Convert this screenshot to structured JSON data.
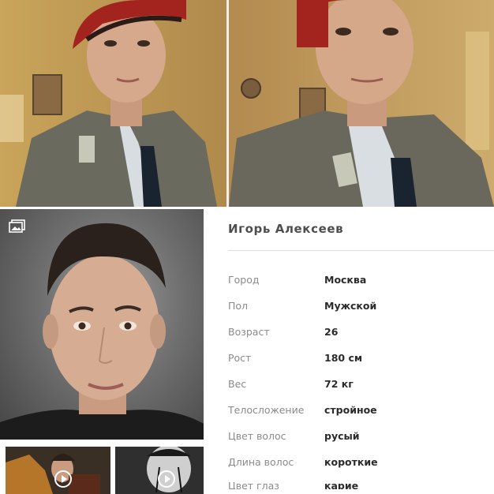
{
  "gallery": {
    "icon": "gallery-icon",
    "video_play_icon": "play-icon"
  },
  "profile": {
    "name": "Игорь Алексеев",
    "fields": [
      {
        "label": "Город",
        "value": "Москва"
      },
      {
        "label": "Пол",
        "value": "Мужской"
      },
      {
        "label": "Возраст",
        "value": "26"
      },
      {
        "label": "Рост",
        "value": "180 см"
      },
      {
        "label": "Вес",
        "value": "72 кг"
      },
      {
        "label": "Телосложение",
        "value": "стройное"
      },
      {
        "label": "Цвет волос",
        "value": "русый"
      },
      {
        "label": "Длина волос",
        "value": "короткие"
      },
      {
        "label": "Цвет глаз",
        "value": "карие"
      }
    ]
  },
  "colors": {
    "name_text": "#4e4e4e",
    "label_text": "#8a8a8a",
    "value_text": "#2b2b2b",
    "divider": "#dcdcdc"
  }
}
